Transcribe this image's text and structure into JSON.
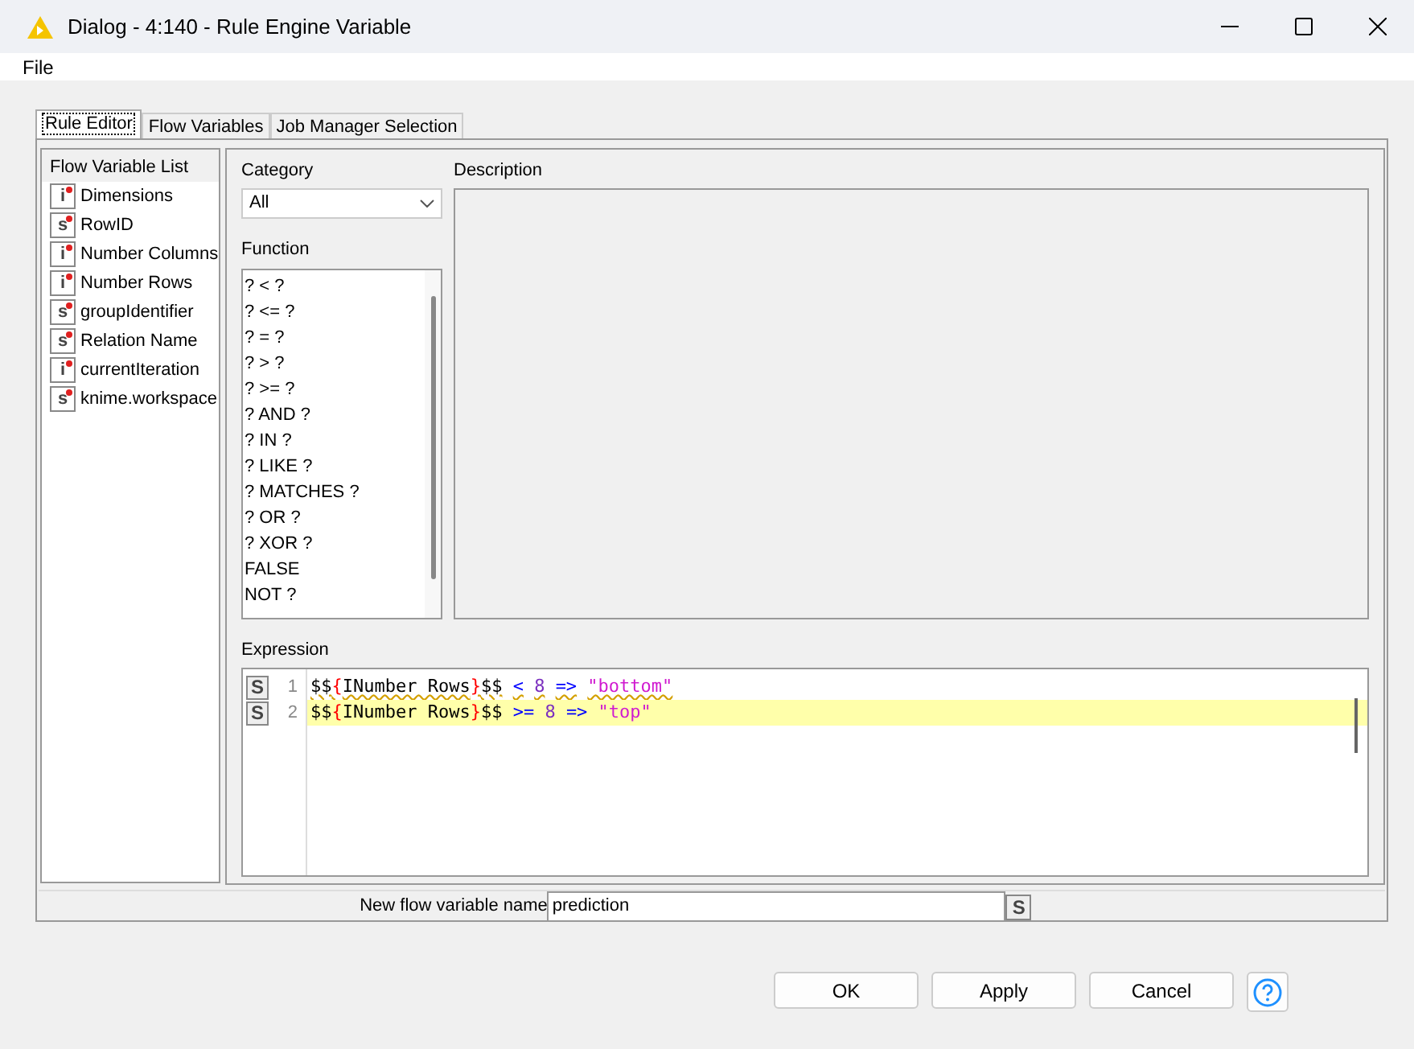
{
  "window": {
    "title": "Dialog - 4:140 - Rule Engine Variable"
  },
  "menu": [
    "File"
  ],
  "tabs": [
    {
      "label": "Rule Editor",
      "selected": true
    },
    {
      "label": "Flow Variables",
      "selected": false
    },
    {
      "label": "Job Manager Selection",
      "selected": false
    }
  ],
  "flow_variable_list": {
    "title": "Flow Variable List",
    "items": [
      {
        "type": "i",
        "name": "Dimensions"
      },
      {
        "type": "s",
        "name": "RowID"
      },
      {
        "type": "i",
        "name": "Number Columns"
      },
      {
        "type": "i",
        "name": "Number Rows"
      },
      {
        "type": "s",
        "name": "groupIdentifier"
      },
      {
        "type": "s",
        "name": "Relation Name"
      },
      {
        "type": "i",
        "name": "currentIteration"
      },
      {
        "type": "s",
        "name": "knime.workspace"
      }
    ]
  },
  "category": {
    "label": "Category",
    "value": "All"
  },
  "function": {
    "label": "Function",
    "items": [
      "? < ?",
      "? <= ?",
      "? = ?",
      "? > ?",
      "? >= ?",
      "? AND ?",
      "? IN ?",
      "? LIKE ?",
      "? MATCHES ?",
      "? OR ?",
      "? XOR ?",
      "FALSE",
      "NOT ?"
    ]
  },
  "description": {
    "label": "Description"
  },
  "expression": {
    "label": "Expression",
    "lines": [
      {
        "marker": "S",
        "number": "1",
        "current": false,
        "warning": true,
        "tokens": [
          {
            "kind": "var",
            "text": "$$"
          },
          {
            "kind": "brace",
            "text": "{"
          },
          {
            "kind": "var",
            "text": "INumber Rows"
          },
          {
            "kind": "brace",
            "text": "}"
          },
          {
            "kind": "var",
            "text": "$$"
          },
          {
            "kind": "op",
            "text": "<"
          },
          {
            "kind": "num",
            "text": "8"
          },
          {
            "kind": "op",
            "text": "=>"
          },
          {
            "kind": "str",
            "text": "\"bottom\""
          }
        ]
      },
      {
        "marker": "S",
        "number": "2",
        "current": true,
        "warning": false,
        "tokens": [
          {
            "kind": "var",
            "text": "$$"
          },
          {
            "kind": "brace",
            "text": "{"
          },
          {
            "kind": "var",
            "text": "INumber Rows"
          },
          {
            "kind": "brace",
            "text": "}"
          },
          {
            "kind": "var",
            "text": "$$"
          },
          {
            "kind": "op",
            "text": ">="
          },
          {
            "kind": "num",
            "text": "8"
          },
          {
            "kind": "op",
            "text": "=>"
          },
          {
            "kind": "str",
            "text": "\"top\""
          }
        ]
      }
    ]
  },
  "new_variable": {
    "label": "New flow variable name",
    "value": "prediction",
    "type_button": "S"
  },
  "buttons": [
    "OK",
    "Apply",
    "Cancel"
  ]
}
